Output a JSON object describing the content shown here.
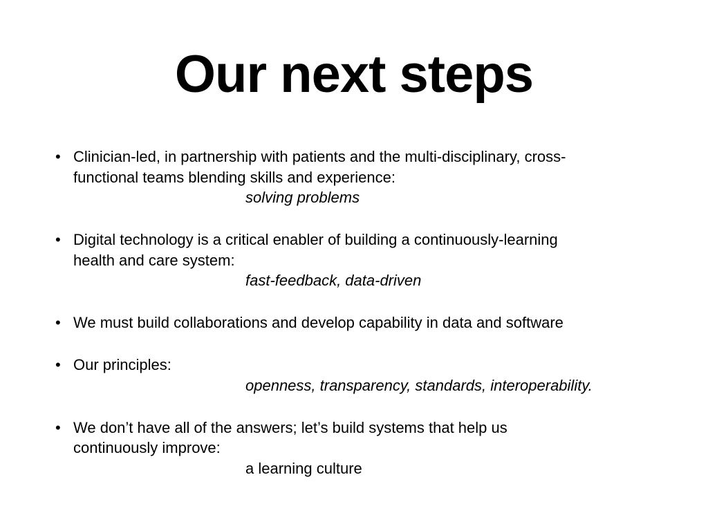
{
  "slide": {
    "title": "Our next steps",
    "bullets": [
      {
        "lines": [
          "Clinician-led, in partnership with patients and the multi-disciplinary, cross-",
          "functional teams blending skills and experience:"
        ],
        "sub": "solving problems",
        "sub_italic": true
      },
      {
        "lines": [
          "Digital technology is a critical enabler of building a continuously-learning",
          "health and care system:"
        ],
        "sub": "fast-feedback, data-driven",
        "sub_italic": true
      },
      {
        "lines": [
          "We must build collaborations and develop capability in data and software"
        ],
        "sub": "",
        "sub_italic": false
      },
      {
        "lines": [
          "Our principles:"
        ],
        "sub": "openness, transparency, standards, interoperability.",
        "sub_italic": true
      },
      {
        "lines": [
          "We don’t have all of the answers; let’s build systems that help us",
          "continuously improve:"
        ],
        "sub": "a learning culture",
        "sub_italic": false
      }
    ]
  }
}
